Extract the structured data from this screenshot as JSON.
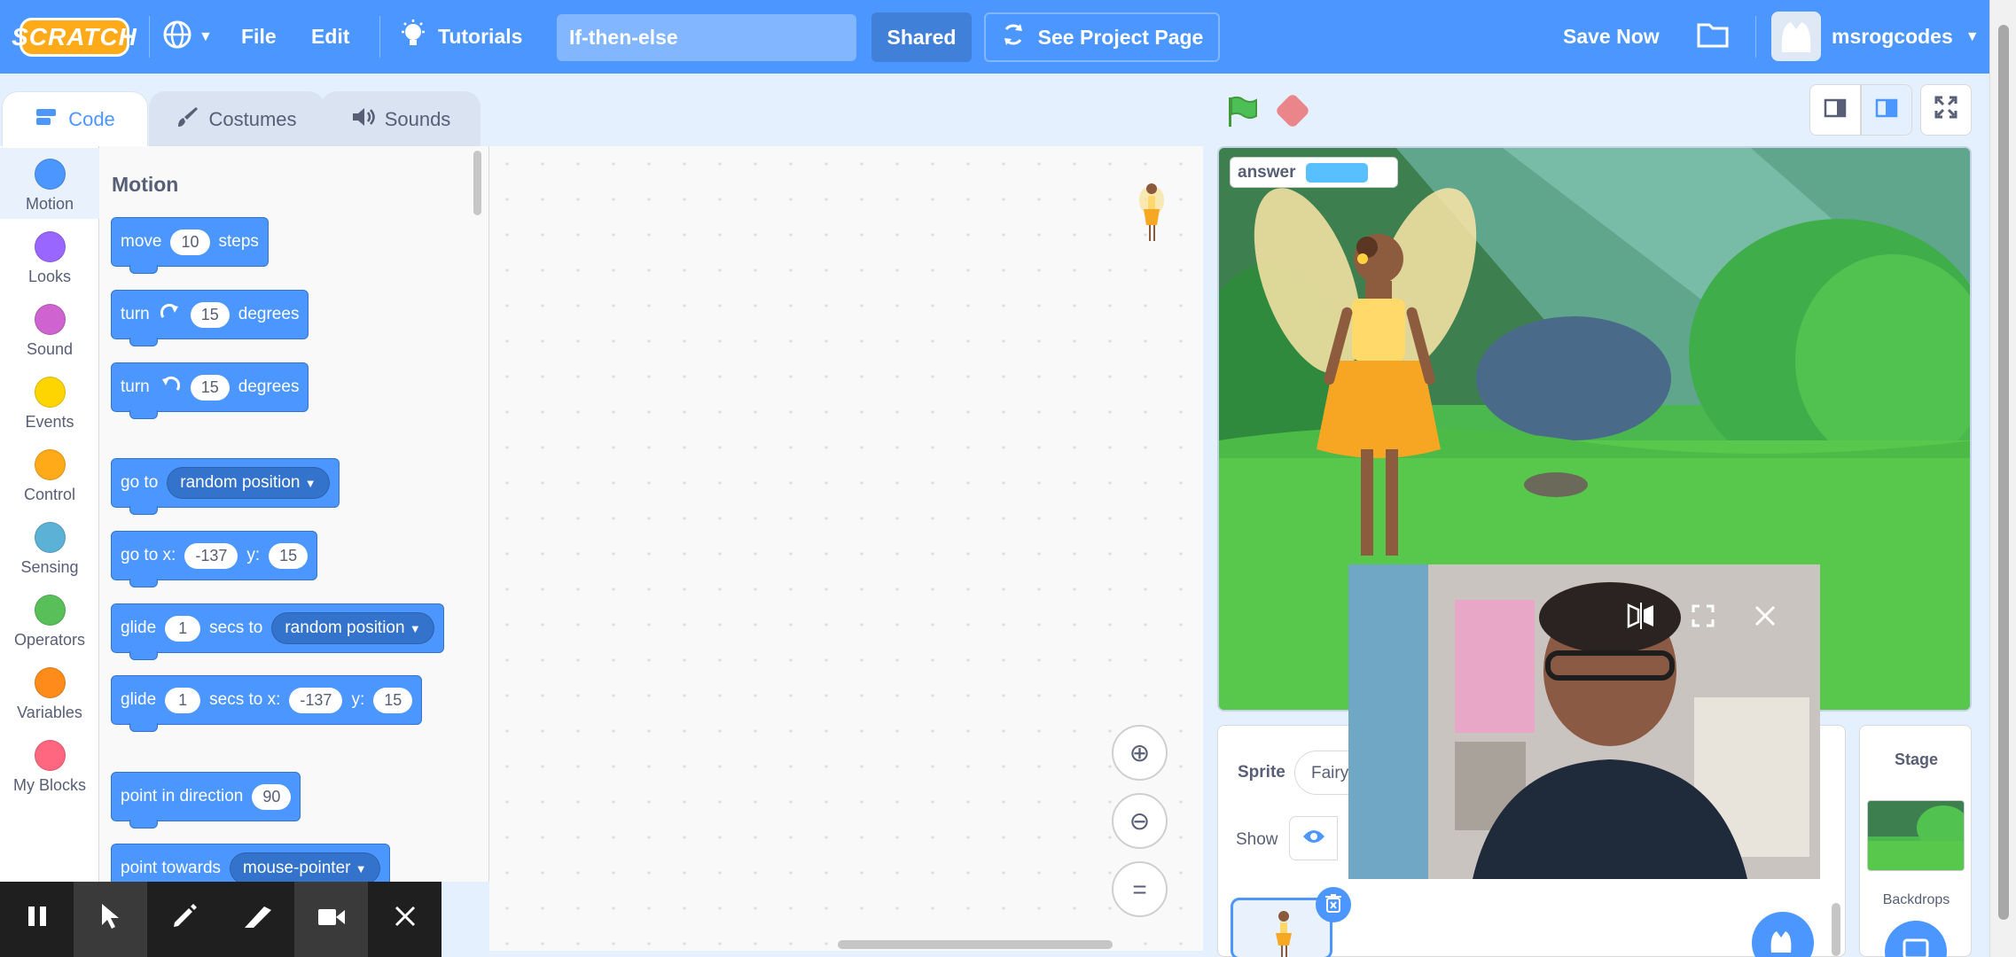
{
  "menubar": {
    "logo": "SCRATCH",
    "file": "File",
    "edit": "Edit",
    "tutorials": "Tutorials",
    "project_title": "If-then-else",
    "shared": "Shared",
    "see_project_page": "See Project Page",
    "save_now": "Save Now",
    "username": "msrogcodes"
  },
  "tabs": [
    {
      "label": "Code",
      "icon": "code-icon"
    },
    {
      "label": "Costumes",
      "icon": "brush-icon"
    },
    {
      "label": "Sounds",
      "icon": "speaker-icon"
    }
  ],
  "categories": [
    {
      "label": "Motion",
      "color": "#4c97ff"
    },
    {
      "label": "Looks",
      "color": "#9966ff"
    },
    {
      "label": "Sound",
      "color": "#cf63cf"
    },
    {
      "label": "Events",
      "color": "#ffd500"
    },
    {
      "label": "Control",
      "color": "#ffab19"
    },
    {
      "label": "Sensing",
      "color": "#5cb1d6"
    },
    {
      "label": "Operators",
      "color": "#59c059"
    },
    {
      "label": "Variables",
      "color": "#ff8c1a"
    },
    {
      "label": "My Blocks",
      "color": "#ff6680"
    }
  ],
  "palette": {
    "section_title": "Motion",
    "blocks": {
      "move": {
        "text1": "move",
        "value": "10",
        "text2": "steps"
      },
      "turn_right": {
        "text1": "turn",
        "value": "15",
        "text2": "degrees"
      },
      "turn_left": {
        "text1": "turn",
        "value": "15",
        "text2": "degrees"
      },
      "goto": {
        "text1": "go to",
        "dropdown": "random position"
      },
      "goto_xy": {
        "text1": "go to x:",
        "x": "-137",
        "text2": "y:",
        "y": "15"
      },
      "glide_to": {
        "text1": "glide",
        "value": "1",
        "text2": "secs to",
        "dropdown": "random position"
      },
      "glide_xy": {
        "text1": "glide",
        "value": "1",
        "text2": "secs to x:",
        "x": "-137",
        "text3": "y:",
        "y": "15"
      },
      "point_dir": {
        "text1": "point in direction",
        "value": "90"
      },
      "point_towards": {
        "text1": "point towards",
        "dropdown": "mouse-pointer"
      }
    }
  },
  "stage": {
    "monitor_label": "answer"
  },
  "sprite_info": {
    "sprite_label": "Sprite",
    "sprite_name": "Fairy",
    "show_label": "Show"
  },
  "stage_pane": {
    "title": "Stage",
    "backdrops_label": "Backdrops"
  },
  "colors": {
    "menubar": "#4c97ff",
    "accent": "#4c97ff"
  }
}
